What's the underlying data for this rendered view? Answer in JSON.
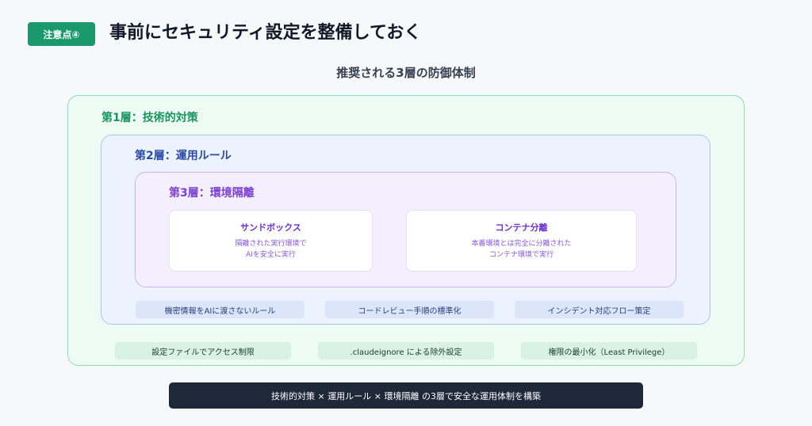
{
  "header": {
    "badge": "注意点④",
    "title": "事前にセキュリティ設定を整備しておく"
  },
  "diagram": {
    "subtitle": "推奨される3層の防御体制",
    "layer1": {
      "label": "第1層：技術的対策",
      "items": [
        "設定ファイルでアクセス制限",
        ".claudeignore による除外設定",
        "権限の最小化（Least Privilege）"
      ]
    },
    "layer2": {
      "label": "第2層：運用ルール",
      "items": [
        "機密情報をAIに渡さないルール",
        "コードレビュー手順の標準化",
        "インシデント対応フロー策定"
      ]
    },
    "layer3": {
      "label": "第3層：環境隔離",
      "cards": [
        {
          "title": "サンドボックス",
          "line1": "隔離された実行環境で",
          "line2": "AIを安全に実行"
        },
        {
          "title": "コンテナ分離",
          "line1": "本番環境とは完全に分離された",
          "line2": "コンテナ環境で実行"
        }
      ]
    },
    "footer": "技術的対策 × 運用ルール × 環境隔離 の3層で安全な運用体制を構築"
  },
  "colors": {
    "badge": "#1a9a6c",
    "layer1": "#86e2b6",
    "layer2": "#a9c4f2",
    "layer3": "#c8b2f2",
    "footer": "#1f2838"
  }
}
